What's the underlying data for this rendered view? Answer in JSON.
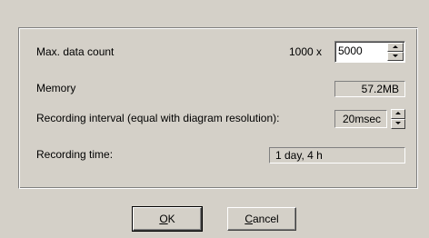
{
  "settings": {
    "max_data_count": {
      "label": "Max. data count",
      "multiplier": "1000 x",
      "value": "5000"
    },
    "memory": {
      "label": "Memory",
      "value": "57.2MB"
    },
    "recording_interval": {
      "label": "Recording interval (equal with diagram resolution):",
      "value": "20msec"
    },
    "recording_time": {
      "label": "Recording time:",
      "value": "1 day, 4 h"
    }
  },
  "buttons": {
    "ok": {
      "mnemonic": "O",
      "rest": "K"
    },
    "cancel": {
      "mnemonic": "C",
      "rest": "ancel"
    }
  }
}
